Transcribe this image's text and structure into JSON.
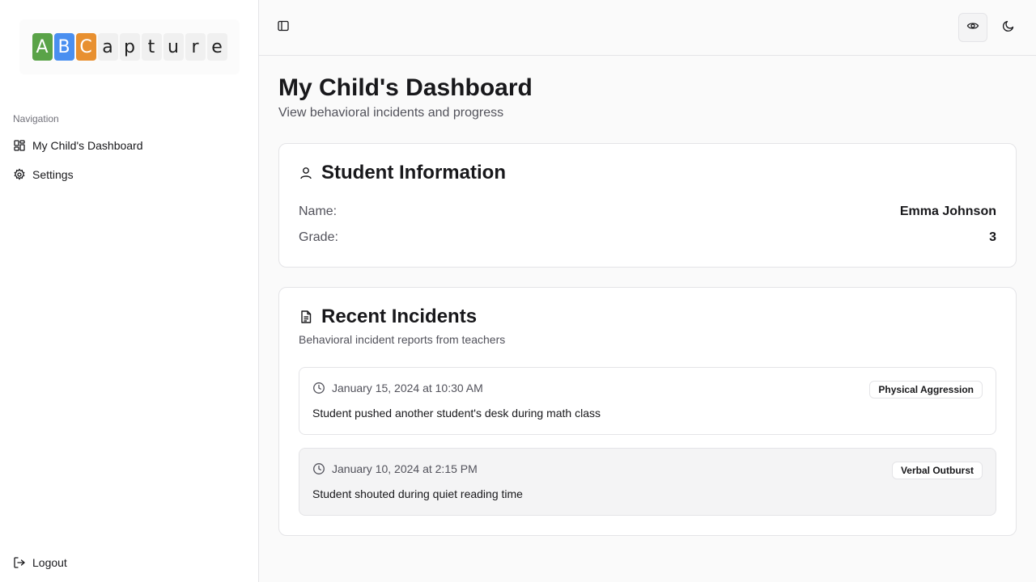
{
  "app": {
    "logo_letters": [
      {
        "char": "A",
        "color": "#5aa348"
      },
      {
        "char": "B",
        "color": "#4a8ff0"
      },
      {
        "char": "C",
        "color": "#e89030"
      },
      {
        "char": "a",
        "color": ""
      },
      {
        "char": "p",
        "color": ""
      },
      {
        "char": "t",
        "color": ""
      },
      {
        "char": "u",
        "color": ""
      },
      {
        "char": "r",
        "color": ""
      },
      {
        "char": "e",
        "color": ""
      }
    ]
  },
  "sidebar": {
    "section_label": "Navigation",
    "items": [
      {
        "label": "My Child's Dashboard",
        "icon": "layout-dashboard-icon"
      },
      {
        "label": "Settings",
        "icon": "gear-icon"
      }
    ],
    "logout_label": "Logout"
  },
  "topbar": {
    "toggle_icon": "panel-left-icon",
    "view_icon": "eye-icon",
    "theme_icon": "moon-icon"
  },
  "page": {
    "title": "My Child's Dashboard",
    "subtitle": "View behavioral incidents and progress"
  },
  "student_info": {
    "title": "Student Information",
    "name_label": "Name:",
    "name_value": "Emma Johnson",
    "grade_label": "Grade:",
    "grade_value": "3"
  },
  "incidents": {
    "title": "Recent Incidents",
    "description": "Behavioral incident reports from teachers",
    "items": [
      {
        "date": "January 15, 2024 at 10:30 AM",
        "type": "Physical Aggression",
        "description": "Student pushed another student's desk during math class"
      },
      {
        "date": "January 10, 2024 at 2:15 PM",
        "type": "Verbal Outburst",
        "description": "Student shouted during quiet reading time"
      }
    ]
  }
}
